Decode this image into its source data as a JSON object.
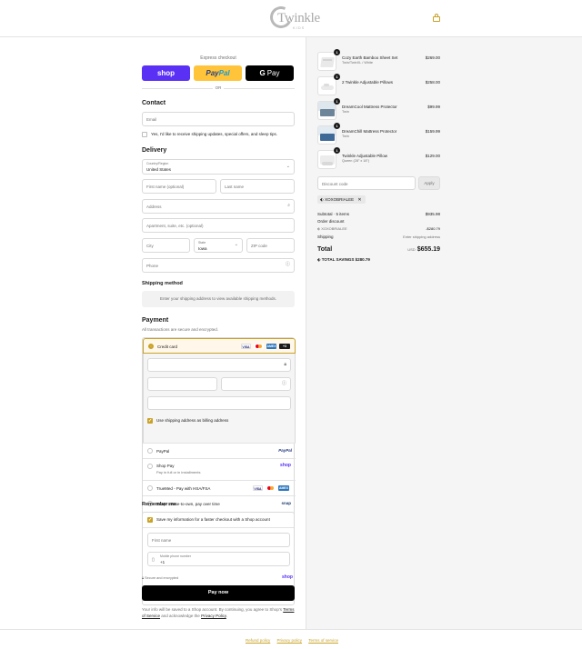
{
  "brand": {
    "name": "Twinkle",
    "sub": "KIDS"
  },
  "express": {
    "title": "Express checkout",
    "shop": "shop",
    "paypal_a": "Pay",
    "paypal_b": "Pal",
    "gpay_g": "G",
    "gpay": "Pay",
    "or": "OR"
  },
  "contact": {
    "heading": "Contact",
    "email_placeholder": "Email",
    "optin_label": "Yes, I'd like to receive shipping updates, special offers, and sleep tips."
  },
  "delivery": {
    "heading": "Delivery",
    "country_label": "Country/Region",
    "country_value": "United States",
    "first_name": "First name (optional)",
    "last_name": "Last name",
    "address": "Address",
    "apartment": "Apartment, suite, etc. (optional)",
    "city": "City",
    "state_label": "State",
    "state_value": "Iowa",
    "zip": "ZIP code",
    "phone": "Phone"
  },
  "shipping": {
    "heading": "Shipping method",
    "note": "Enter your shipping address to view available shipping methods."
  },
  "payment": {
    "heading": "Payment",
    "subtitle": "All transactions are secure and encrypted.",
    "credit_card": "Credit card",
    "card_more": "+3",
    "billing_same": "Use shipping address as billing address",
    "paypal": "PayPal",
    "paypal_logo": "PayPal",
    "shop_pay": "Shop Pay",
    "shop_pay_sub": "Pay in full or in installments",
    "shop_logo": "shop",
    "truemed": "TrueMed - Pay with HSA/FSA",
    "snap": "Snap! Lease-to-own, pay over time",
    "snap_logo": "snap"
  },
  "remember": {
    "heading": "Remember me",
    "save_label": "Save my information for a faster checkout with a Shop account",
    "first_name": "First name",
    "mobile_label": "Mobile phone number",
    "mobile_value": "+1",
    "secure": "Secure and encrypted",
    "shop": "shop"
  },
  "pay_now": "Pay now",
  "legal": {
    "text1": "Your info will be saved to a Shop account. By continuing, you agree to Shop's",
    "terms": "Terms of Service",
    "text2": "and acknowledge the",
    "privacy": "Privacy Policy",
    "end": "."
  },
  "cart": {
    "items": [
      {
        "name": "Cozy Earth Bamboo Sheet Set",
        "variant": "Twin/TwinXL / White",
        "price": "$269.00",
        "qty": "1"
      },
      {
        "name": "2 Twinkle Adjustable Pillows",
        "variant": "",
        "price": "$258.00",
        "qty": "1"
      },
      {
        "name": "DreamCool Mattress Protector",
        "variant": "Twin",
        "price": "$99.99",
        "qty": "1"
      },
      {
        "name": "DreamChill Mattress Protector",
        "variant": "Twin",
        "price": "$159.99",
        "qty": "1"
      },
      {
        "name": "Twinkle Adjustable Pillow",
        "variant": "Queen (28\" x 18\")",
        "price": "$129.00",
        "qty": "1"
      }
    ],
    "discount_placeholder": "Discount code",
    "apply": "Apply",
    "code": "XOXOBRIALEE",
    "subtotal_label": "Subtotal · 5 items",
    "subtotal": "$935.98",
    "order_discount": "Order discount",
    "discount_code": "XOXOBRIALEE",
    "discount_amount": "-$280.79",
    "shipping_label": "Shipping",
    "shipping_value": "Enter shipping address",
    "total_label": "Total",
    "currency": "USD",
    "total": "$655.19",
    "savings_label": "TOTAL SAVINGS",
    "savings": "$280.79"
  },
  "footer": {
    "refund": "Refund policy",
    "privacy": "Privacy policy",
    "terms": "Terms of service"
  },
  "colors": {
    "accent": "#c9a227",
    "shop": "#5a31f4",
    "paypal": "#ffc439"
  }
}
